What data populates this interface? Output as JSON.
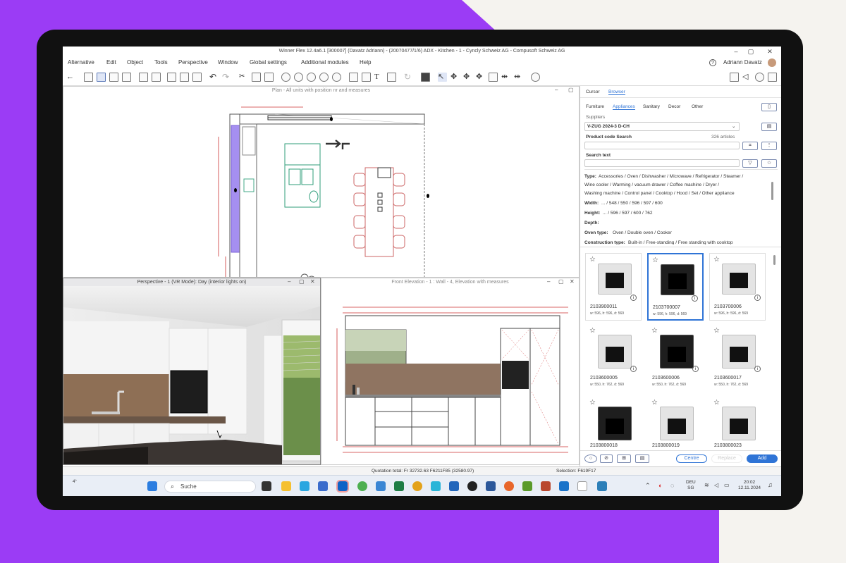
{
  "app": {
    "title": "Winner Flex 12.4a6.1  [300007]  (Davatz Adriann) - (20070477/1/6) ADX - Kitchen - 1 - Cyncly Schweiz AG - Compusoft Schweiz AG",
    "user": "Adriann Davatz",
    "help_icon": "?"
  },
  "menu": [
    "Alternative",
    "Edit",
    "Object",
    "Tools",
    "Perspective",
    "Window",
    "Global settings",
    "Additional modules",
    "Help"
  ],
  "panes": {
    "plan_title": "Plan - All units with position nr and measures",
    "perspective_title": "Perspective - 1 (VR Mode): Day (interior lights on)",
    "elevation_title": "Front Elevation - 1 : Wall - 4, Elevation with measures"
  },
  "right_panel": {
    "tabs": [
      "Cursor",
      "Browser"
    ],
    "categories": [
      "Furniture",
      "Appliances",
      "Sanitary",
      "Decor",
      "Other"
    ],
    "suppliers_label": "Suppliers",
    "supplier_value": "V-ZUG 2024-3 D-CH",
    "product_code_label": "Product code Search",
    "articles_count": "326 articles",
    "search_text_label": "Search text",
    "filters": [
      {
        "label": "Type:",
        "text": "Accessories / Oven / Dishwasher / Microwave / Refrigerator / Steamer /"
      },
      {
        "label": "",
        "text": "Wine cooler / Warming / vacuum drawer / Coffee machine / Dryer /"
      },
      {
        "label": "",
        "text": "Washing machine / Control panel / Cooktop / Hood / Set / Other appliance"
      },
      {
        "label": "Width:",
        "text": "... / 548 / 550 / 596 / 597 / 600"
      },
      {
        "label": "Height:",
        "text": "... / 596 / 597 / 600 / 762"
      },
      {
        "label": "Depth:",
        "text": ""
      },
      {
        "label": "Oven type:",
        "text": "Oven / Double oven / Cooker"
      },
      {
        "label": "Construction type:",
        "text": "Built-in / Free-standing / Free standing with cooktop"
      }
    ],
    "products": [
      {
        "code": "2103900011",
        "dims": "w: 596, h: 596, d: 569",
        "tone": "light",
        "selected": false
      },
      {
        "code": "2103700007",
        "dims": "w: 596, h: 596, d: 569",
        "tone": "dark",
        "selected": true
      },
      {
        "code": "2103700006",
        "dims": "w: 596, h: 596, d: 569",
        "tone": "light",
        "selected": false
      },
      {
        "code": "2103600005",
        "dims": "w: 550, h: 762, d: 569",
        "tone": "light",
        "selected": false
      },
      {
        "code": "2103600006",
        "dims": "w: 550, h: 762, d: 569",
        "tone": "dark",
        "selected": false
      },
      {
        "code": "2103600017",
        "dims": "w: 550, h: 762, d: 569",
        "tone": "light",
        "selected": false
      },
      {
        "code": "2103800018",
        "dims": "",
        "tone": "dark",
        "selected": false
      },
      {
        "code": "2103800019",
        "dims": "",
        "tone": "dark",
        "selected": false
      },
      {
        "code": "2103800023",
        "dims": "",
        "tone": "light",
        "selected": false
      }
    ],
    "centre_label": "Centre",
    "replace_label": "Replace",
    "add_label": "Add"
  },
  "status": {
    "quotation": "Quotation total: Fr 32732.63  F6211F85 (32580.97)",
    "selection": "Selection: F619F17"
  },
  "taskbar": {
    "weather": "4°",
    "search": "Suche",
    "lang": "DEU",
    "lang2": "SG",
    "time": "20:02",
    "date": "12.11.2024"
  },
  "colors": {
    "accent": "#2f74d6",
    "purple": "#9b3cf5"
  }
}
